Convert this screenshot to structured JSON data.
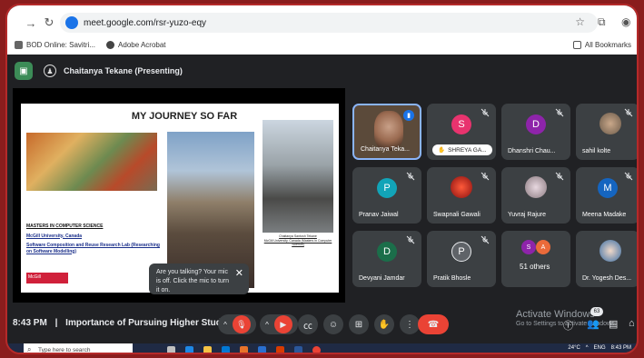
{
  "browser": {
    "url": "meet.google.com/rsr-yuzo-eqy",
    "bookmarks": [
      "BOD Online: Savitri...",
      "Adobe Acrobat"
    ],
    "bookmarks_right": "All Bookmarks"
  },
  "meeting": {
    "presenter_label": "Chaitanya Tekane (Presenting)",
    "time": "8:43 PM",
    "separator": "|",
    "title": "Importance of Pursuing Higher Studies",
    "participant_badge": "63"
  },
  "slide": {
    "title": "MY JOURNEY SO FAR",
    "degree": "MASTERS IN COMPUTER SCIENCE",
    "university": "McGill University, Canada",
    "lab": "Software Composition and Reuse Research Lab (Researching on Software Modelling)",
    "logo": "McGill",
    "caption_name": "Chaitanya Santosh Tekane",
    "caption_detail": "McGill University, Canada (Masters in Computer Science)"
  },
  "participants": [
    {
      "name": "Chaitanya Teka...",
      "initial": "",
      "color": "",
      "type": "video"
    },
    {
      "name": "SHREYA GA...",
      "initial": "S",
      "color": "#e8336e",
      "type": "pill"
    },
    {
      "name": "Dhanshri Chau...",
      "initial": "D",
      "color": "#8e24aa",
      "type": "initial"
    },
    {
      "name": "sahil kolte",
      "initial": "",
      "color": "#6b5a4a",
      "type": "photo"
    },
    {
      "name": "Pranav Jaiwal",
      "initial": "P",
      "color": "#12a4b8",
      "type": "initial"
    },
    {
      "name": "Swapnali Gawali",
      "initial": "",
      "color": "#d32f2f",
      "type": "photo"
    },
    {
      "name": "Yuvraj Rajure",
      "initial": "",
      "color": "#b0a0a8",
      "type": "photo"
    },
    {
      "name": "Meena Madake",
      "initial": "M",
      "color": "#1565c0",
      "type": "initial"
    },
    {
      "name": "Devyani Jamdar",
      "initial": "D",
      "color": "#1b6e4a",
      "type": "initial"
    },
    {
      "name": "Pratik Bhosle",
      "initial": "P",
      "color": "#5f6368",
      "type": "initial"
    },
    {
      "name": "51 others",
      "initial": "",
      "color": "",
      "type": "others"
    },
    {
      "name": "Dr. Yogesh Des...",
      "initial": "",
      "color": "#3a6ea5",
      "type": "photo"
    }
  ],
  "others_initials": [
    "S",
    "A"
  ],
  "tooltip": {
    "text": "Are you talking? Your mic is off. Click the mic to turn it on.",
    "close": "✕"
  },
  "activate": {
    "title": "Activate Windows",
    "subtitle": "Go to Settings to activate Windows."
  },
  "taskbar": {
    "search_placeholder": "Type here to search",
    "weather": "24°C",
    "lang": "ENG",
    "clock": "8:43 PM"
  }
}
